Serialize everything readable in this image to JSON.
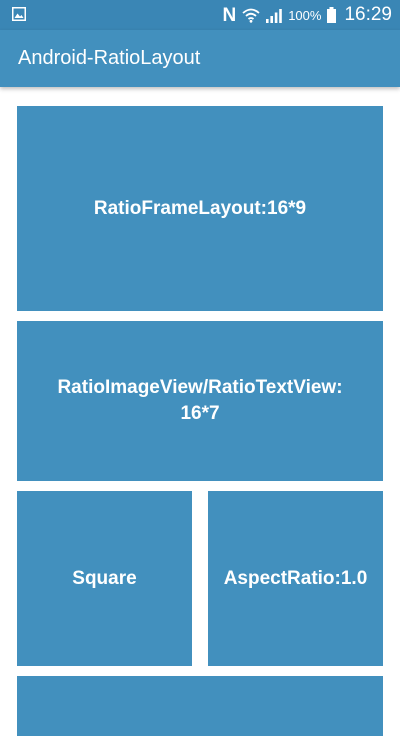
{
  "status_bar": {
    "battery": "100%",
    "time": "16:29",
    "icons": [
      "gallery-icon",
      "nfc-icon",
      "wifi-icon",
      "signal-icon",
      "battery-icon"
    ]
  },
  "app_bar": {
    "title": "Android-RatioLayout"
  },
  "tiles": [
    {
      "label": "RatioFrameLayout:16*9"
    },
    {
      "label": "RatioImageView/RatioTextView:\n16*7"
    },
    {
      "label": "Square"
    },
    {
      "label": "AspectRatio:1.0"
    },
    {
      "label": ""
    }
  ],
  "colors": {
    "status_bar": "#3a86b5",
    "app_bar": "#4290be",
    "tile": "#4290be",
    "background": "#ffffff"
  }
}
